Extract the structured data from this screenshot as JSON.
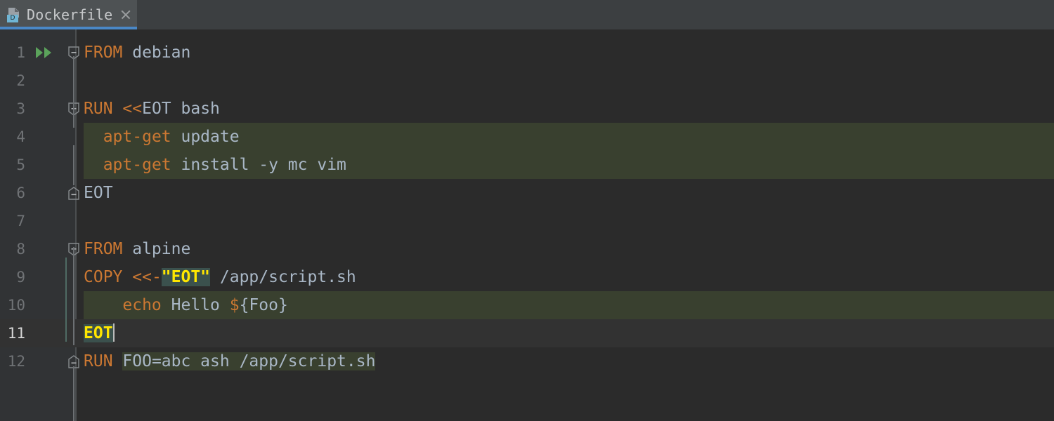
{
  "window": {
    "background": "#2b2b2b",
    "accent": "#4a88c7"
  },
  "tabbar": {
    "tabs": [
      {
        "label": "Dockerfile",
        "icon": "dockerfile-icon",
        "badge": "D",
        "active": true,
        "close_icon": "close-icon"
      }
    ]
  },
  "editor": {
    "language": "Dockerfile",
    "current_line": 11,
    "caret_line": 11,
    "caret_column": 4,
    "colors": {
      "editor_background": "#2b2b2b",
      "gutter_background": "#313335",
      "keyword": "#cc7832",
      "text": "#a9b7c6",
      "injected_shell_background": "#39402f",
      "brace_match_highlight": "#3b514d",
      "brace_match_text": "#ffe600",
      "current_line_background": "#323232",
      "run_gutter_icon": "#5a9e5a"
    },
    "line_numbers": [
      "1",
      "2",
      "3",
      "4",
      "5",
      "6",
      "7",
      "8",
      "9",
      "10",
      "11",
      "12"
    ],
    "lines": [
      {
        "number": "1",
        "gutter_icon": "run-double-chevron-icon",
        "fold": "collapse-start",
        "tokens": [
          {
            "text": "FROM",
            "style": "keyword"
          },
          {
            "text": " debian",
            "style": "text"
          }
        ]
      },
      {
        "number": "2",
        "gutter_icon": null,
        "fold": null,
        "tokens": []
      },
      {
        "number": "3",
        "gutter_icon": null,
        "fold": "collapse-start",
        "tokens": [
          {
            "text": "RUN",
            "style": "keyword"
          },
          {
            "text": " ",
            "style": "text"
          },
          {
            "text": "<<",
            "style": "operator"
          },
          {
            "text": "EOT bash",
            "style": "text"
          }
        ]
      },
      {
        "number": "4",
        "gutter_icon": null,
        "fold": null,
        "shell_block": true,
        "tokens": [
          {
            "text": "  ",
            "style": "text"
          },
          {
            "text": "apt-get",
            "style": "keyword"
          },
          {
            "text": " update",
            "style": "text"
          }
        ]
      },
      {
        "number": "5",
        "gutter_icon": null,
        "fold": null,
        "shell_block": true,
        "tokens": [
          {
            "text": "  ",
            "style": "text"
          },
          {
            "text": "apt-get",
            "style": "keyword"
          },
          {
            "text": " install -y mc vim",
            "style": "text"
          }
        ]
      },
      {
        "number": "6",
        "gutter_icon": null,
        "fold": "collapse-end",
        "tokens": [
          {
            "text": "EOT",
            "style": "text"
          }
        ]
      },
      {
        "number": "7",
        "gutter_icon": null,
        "fold": null,
        "tokens": []
      },
      {
        "number": "8",
        "gutter_icon": null,
        "fold": "collapse-start",
        "tokens": [
          {
            "text": "FROM",
            "style": "keyword"
          },
          {
            "text": " alpine",
            "style": "text"
          }
        ]
      },
      {
        "number": "9",
        "gutter_icon": null,
        "fold": null,
        "tokens": [
          {
            "text": "COPY",
            "style": "keyword"
          },
          {
            "text": " ",
            "style": "text"
          },
          {
            "text": "<<-",
            "style": "operator"
          },
          {
            "text": "\"EOT\"",
            "style": "highlight"
          },
          {
            "text": " /app/script.sh",
            "style": "text"
          }
        ]
      },
      {
        "number": "10",
        "gutter_icon": null,
        "fold": null,
        "shell_block": true,
        "tokens": [
          {
            "text": "    ",
            "style": "text"
          },
          {
            "text": "echo",
            "style": "keyword"
          },
          {
            "text": " Hello ",
            "style": "text"
          },
          {
            "text": "$",
            "style": "keyword"
          },
          {
            "text": "{Foo}",
            "style": "text"
          }
        ]
      },
      {
        "number": "11",
        "gutter_icon": null,
        "fold": null,
        "current": true,
        "caret": true,
        "tokens": [
          {
            "text": "EOT",
            "style": "highlight"
          }
        ]
      },
      {
        "number": "12",
        "gutter_icon": null,
        "fold": "collapse-end",
        "tokens": [
          {
            "text": "RUN",
            "style": "keyword"
          },
          {
            "text": " ",
            "style": "text"
          },
          {
            "text": "FOO=abc ash /app/script.sh",
            "style": "shell-inline"
          }
        ]
      }
    ]
  }
}
